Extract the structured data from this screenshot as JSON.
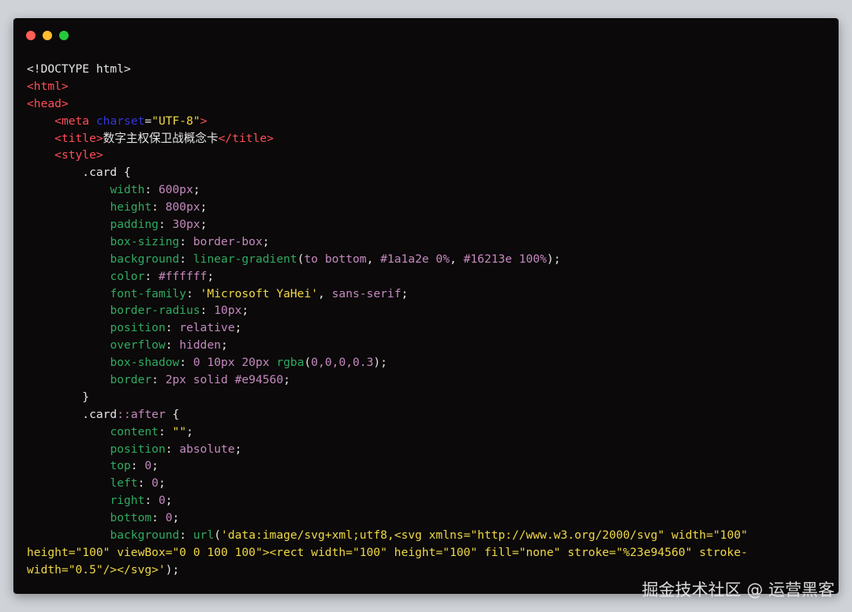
{
  "window": {
    "buttons": [
      {
        "name": "close",
        "color": "#ff5f56"
      },
      {
        "name": "minimize",
        "color": "#ffbd2e"
      },
      {
        "name": "zoom",
        "color": "#27c93f"
      }
    ]
  },
  "colors": {
    "default": "#e6e6e6",
    "tag": "#ff4d5a",
    "attr": "#3535d8",
    "string": "#f0d847",
    "prop": "#2faa62",
    "value": "#c489bf",
    "background": "#0b0909"
  },
  "code_lines": [
    [
      {
        "t": "<!DOCTYPE html>",
        "c": "default"
      }
    ],
    [
      {
        "t": "<html>",
        "c": "tag"
      }
    ],
    [
      {
        "t": "<head>",
        "c": "tag"
      }
    ],
    [
      {
        "t": "    ",
        "c": "default"
      },
      {
        "t": "<meta",
        "c": "tag"
      },
      {
        "t": " ",
        "c": "default"
      },
      {
        "t": "charset",
        "c": "attr"
      },
      {
        "t": "=",
        "c": "default"
      },
      {
        "t": "\"UTF-8\"",
        "c": "string"
      },
      {
        "t": ">",
        "c": "tag"
      }
    ],
    [
      {
        "t": "    ",
        "c": "default"
      },
      {
        "t": "<title>",
        "c": "tag"
      },
      {
        "t": "数字主权保卫战概念卡",
        "c": "default"
      },
      {
        "t": "</title>",
        "c": "tag"
      }
    ],
    [
      {
        "t": "    ",
        "c": "default"
      },
      {
        "t": "<style>",
        "c": "tag"
      }
    ],
    [
      {
        "t": "        .card {",
        "c": "default"
      }
    ],
    [
      {
        "t": "            ",
        "c": "default"
      },
      {
        "t": "width",
        "c": "prop"
      },
      {
        "t": ": ",
        "c": "default"
      },
      {
        "t": "600px",
        "c": "value"
      },
      {
        "t": ";",
        "c": "default"
      }
    ],
    [
      {
        "t": "            ",
        "c": "default"
      },
      {
        "t": "height",
        "c": "prop"
      },
      {
        "t": ": ",
        "c": "default"
      },
      {
        "t": "800px",
        "c": "value"
      },
      {
        "t": ";",
        "c": "default"
      }
    ],
    [
      {
        "t": "            ",
        "c": "default"
      },
      {
        "t": "padding",
        "c": "prop"
      },
      {
        "t": ": ",
        "c": "default"
      },
      {
        "t": "30px",
        "c": "value"
      },
      {
        "t": ";",
        "c": "default"
      }
    ],
    [
      {
        "t": "            ",
        "c": "default"
      },
      {
        "t": "box-sizing",
        "c": "prop"
      },
      {
        "t": ": ",
        "c": "default"
      },
      {
        "t": "border-box",
        "c": "value"
      },
      {
        "t": ";",
        "c": "default"
      }
    ],
    [
      {
        "t": "            ",
        "c": "default"
      },
      {
        "t": "background",
        "c": "prop"
      },
      {
        "t": ": ",
        "c": "default"
      },
      {
        "t": "linear-gradient",
        "c": "prop"
      },
      {
        "t": "(",
        "c": "default"
      },
      {
        "t": "to bottom",
        "c": "value"
      },
      {
        "t": ", ",
        "c": "default"
      },
      {
        "t": "#1a1a2e 0%",
        "c": "value"
      },
      {
        "t": ", ",
        "c": "default"
      },
      {
        "t": "#16213e 100%",
        "c": "value"
      },
      {
        "t": ");",
        "c": "default"
      }
    ],
    [
      {
        "t": "            ",
        "c": "default"
      },
      {
        "t": "color",
        "c": "prop"
      },
      {
        "t": ": ",
        "c": "default"
      },
      {
        "t": "#ffffff",
        "c": "value"
      },
      {
        "t": ";",
        "c": "default"
      }
    ],
    [
      {
        "t": "            ",
        "c": "default"
      },
      {
        "t": "font-family",
        "c": "prop"
      },
      {
        "t": ": ",
        "c": "default"
      },
      {
        "t": "'Microsoft YaHei'",
        "c": "string"
      },
      {
        "t": ", ",
        "c": "default"
      },
      {
        "t": "sans-serif",
        "c": "value"
      },
      {
        "t": ";",
        "c": "default"
      }
    ],
    [
      {
        "t": "            ",
        "c": "default"
      },
      {
        "t": "border-radius",
        "c": "prop"
      },
      {
        "t": ": ",
        "c": "default"
      },
      {
        "t": "10px",
        "c": "value"
      },
      {
        "t": ";",
        "c": "default"
      }
    ],
    [
      {
        "t": "            ",
        "c": "default"
      },
      {
        "t": "position",
        "c": "prop"
      },
      {
        "t": ": ",
        "c": "default"
      },
      {
        "t": "relative",
        "c": "value"
      },
      {
        "t": ";",
        "c": "default"
      }
    ],
    [
      {
        "t": "            ",
        "c": "default"
      },
      {
        "t": "overflow",
        "c": "prop"
      },
      {
        "t": ": ",
        "c": "default"
      },
      {
        "t": "hidden",
        "c": "value"
      },
      {
        "t": ";",
        "c": "default"
      }
    ],
    [
      {
        "t": "            ",
        "c": "default"
      },
      {
        "t": "box-shadow",
        "c": "prop"
      },
      {
        "t": ": ",
        "c": "default"
      },
      {
        "t": "0 10px 20px",
        "c": "value"
      },
      {
        "t": " ",
        "c": "default"
      },
      {
        "t": "rgba",
        "c": "prop"
      },
      {
        "t": "(",
        "c": "default"
      },
      {
        "t": "0,0,0,0.3",
        "c": "value"
      },
      {
        "t": ");",
        "c": "default"
      }
    ],
    [
      {
        "t": "            ",
        "c": "default"
      },
      {
        "t": "border",
        "c": "prop"
      },
      {
        "t": ": ",
        "c": "default"
      },
      {
        "t": "2px solid #e94560",
        "c": "value"
      },
      {
        "t": ";",
        "c": "default"
      }
    ],
    [
      {
        "t": "        }",
        "c": "default"
      }
    ],
    [
      {
        "t": "        .card",
        "c": "default"
      },
      {
        "t": "::",
        "c": "value"
      },
      {
        "t": "after",
        "c": "value"
      },
      {
        "t": " {",
        "c": "default"
      }
    ],
    [
      {
        "t": "            ",
        "c": "default"
      },
      {
        "t": "content",
        "c": "prop"
      },
      {
        "t": ": ",
        "c": "default"
      },
      {
        "t": "\"\"",
        "c": "string"
      },
      {
        "t": ";",
        "c": "default"
      }
    ],
    [
      {
        "t": "            ",
        "c": "default"
      },
      {
        "t": "position",
        "c": "prop"
      },
      {
        "t": ": ",
        "c": "default"
      },
      {
        "t": "absolute",
        "c": "value"
      },
      {
        "t": ";",
        "c": "default"
      }
    ],
    [
      {
        "t": "            ",
        "c": "default"
      },
      {
        "t": "top",
        "c": "prop"
      },
      {
        "t": ": ",
        "c": "default"
      },
      {
        "t": "0",
        "c": "value"
      },
      {
        "t": ";",
        "c": "default"
      }
    ],
    [
      {
        "t": "            ",
        "c": "default"
      },
      {
        "t": "left",
        "c": "prop"
      },
      {
        "t": ": ",
        "c": "default"
      },
      {
        "t": "0",
        "c": "value"
      },
      {
        "t": ";",
        "c": "default"
      }
    ],
    [
      {
        "t": "            ",
        "c": "default"
      },
      {
        "t": "right",
        "c": "prop"
      },
      {
        "t": ": ",
        "c": "default"
      },
      {
        "t": "0",
        "c": "value"
      },
      {
        "t": ";",
        "c": "default"
      }
    ],
    [
      {
        "t": "            ",
        "c": "default"
      },
      {
        "t": "bottom",
        "c": "prop"
      },
      {
        "t": ": ",
        "c": "default"
      },
      {
        "t": "0",
        "c": "value"
      },
      {
        "t": ";",
        "c": "default"
      }
    ],
    [
      {
        "t": "            ",
        "c": "default"
      },
      {
        "t": "background",
        "c": "prop"
      },
      {
        "t": ": ",
        "c": "default"
      },
      {
        "t": "url",
        "c": "prop"
      },
      {
        "t": "(",
        "c": "default"
      },
      {
        "t": "'data:image/svg+xml;utf8,<svg xmlns=\"http://www.w3.org/2000/svg\" width=\"100\"",
        "c": "string"
      }
    ],
    [
      {
        "t": "height=\"100\" viewBox=\"0 0 100 100\"><rect width=\"100\" height=\"100\" fill=\"none\" stroke=\"%23e94560\" stroke-",
        "c": "string"
      }
    ],
    [
      {
        "t": "width=\"0.5\"/></svg>'",
        "c": "string"
      },
      {
        "t": ");",
        "c": "default"
      }
    ]
  ],
  "watermark": "掘金技术社区 @ 运营黑客"
}
